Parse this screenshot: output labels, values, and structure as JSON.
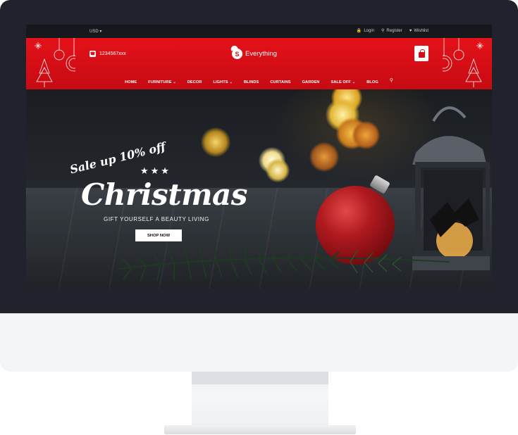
{
  "topbar": {
    "currency": "USD",
    "links": [
      {
        "icon": "lock-icon",
        "label": "Login"
      },
      {
        "icon": "key-icon",
        "label": "Register"
      },
      {
        "icon": "heart-icon",
        "label": "Wishlist"
      }
    ]
  },
  "header": {
    "phone": "1234567xxx",
    "logo_letter": "S",
    "logo_text": "Everything"
  },
  "nav": {
    "items": [
      {
        "label": "HOME",
        "dropdown": false
      },
      {
        "label": "FURNITURE",
        "dropdown": true
      },
      {
        "label": "DECOR",
        "dropdown": false
      },
      {
        "label": "LIGHTS",
        "dropdown": true
      },
      {
        "label": "BLINDS",
        "dropdown": false
      },
      {
        "label": "CURTAINS",
        "dropdown": false
      },
      {
        "label": "GARDEN",
        "dropdown": false
      },
      {
        "label": "SALE OFF",
        "dropdown": true
      },
      {
        "label": "BLOG",
        "dropdown": false
      }
    ]
  },
  "hero": {
    "sale_text": "Sale up 10% off",
    "title": "Christmas",
    "subtitle": "GIFT YOURSELF A BEAUTY LIVING",
    "button_label": "SHOP NOW"
  },
  "colors": {
    "brand_red": "#d30d15",
    "bezel": "#20232b",
    "topbar": "#17181b"
  }
}
